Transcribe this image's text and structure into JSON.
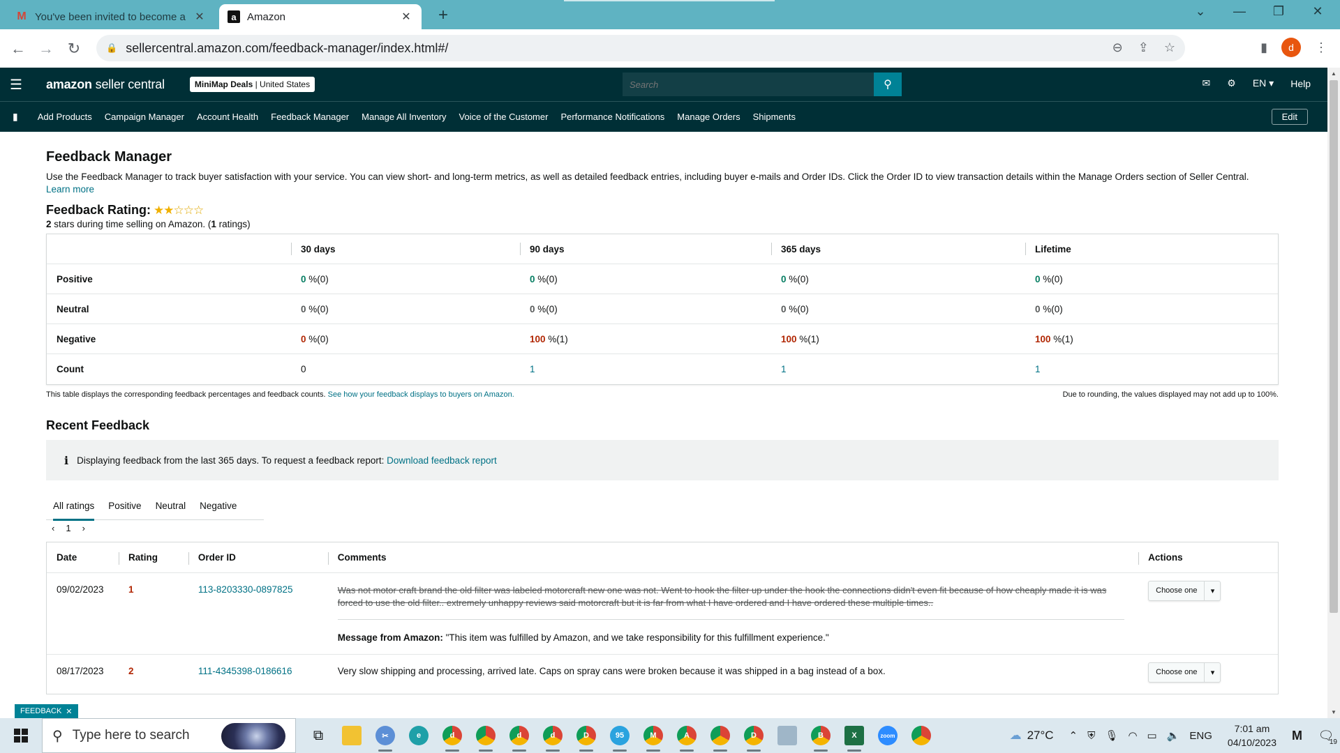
{
  "browser": {
    "tabs": [
      {
        "title": "You've been invited to become a",
        "icon": "gmail-icon",
        "active": false
      },
      {
        "title": "Amazon",
        "icon": "amazon-icon",
        "active": true
      }
    ],
    "url": "sellercentral.amazon.com/feedback-manager/index.html#/",
    "profile_initial": "d"
  },
  "header": {
    "logo_brand": "amazon",
    "logo_product": "seller central",
    "store_name": "MiniMap Deals",
    "store_region": "United States",
    "search_placeholder": "Search",
    "language": "EN",
    "help": "Help"
  },
  "nav": {
    "items": [
      "Add Products",
      "Campaign Manager",
      "Account Health",
      "Feedback Manager",
      "Manage All Inventory",
      "Voice of the Customer",
      "Performance Notifications",
      "Manage Orders",
      "Shipments"
    ],
    "edit": "Edit"
  },
  "page": {
    "title": "Feedback Manager",
    "intro": "Use the Feedback Manager to track buyer satisfaction with your service. You can view short- and long-term metrics, as well as detailed feedback entries, including buyer e-mails and Order IDs. Click the Order ID to view transaction details within the Manage Orders section of Seller Central.",
    "learn_more": "Learn more",
    "rating_label": "Feedback Rating:",
    "rating_stars": 2,
    "rating_max": 5,
    "rating_stars_value": "2",
    "rating_summary_mid": " stars during time selling on Amazon. (",
    "rating_count": "1",
    "rating_summary_end": " ratings)"
  },
  "metrics": {
    "columns": [
      "30 days",
      "90 days",
      "365 days",
      "Lifetime"
    ],
    "rows": [
      {
        "label": "Positive",
        "cells": [
          {
            "num": "0",
            "rest": " %(0)"
          },
          {
            "num": "0",
            "rest": " %(0)"
          },
          {
            "num": "0",
            "rest": " %(0)"
          },
          {
            "num": "0",
            "rest": " %(0)"
          }
        ]
      },
      {
        "label": "Neutral",
        "cells": [
          {
            "num": "0",
            "rest": " %(0)"
          },
          {
            "num": "0",
            "rest": " %(0)"
          },
          {
            "num": "0",
            "rest": " %(0)"
          },
          {
            "num": "0",
            "rest": " %(0)"
          }
        ]
      },
      {
        "label": "Negative",
        "cells": [
          {
            "num": "0",
            "rest": " %(0)"
          },
          {
            "num": "100",
            "rest": " %(1)"
          },
          {
            "num": "100",
            "rest": " %(1)"
          },
          {
            "num": "100",
            "rest": " %(1)"
          }
        ]
      },
      {
        "label": "Count",
        "cells": [
          {
            "num": "0",
            "rest": ""
          },
          {
            "num": "1",
            "rest": ""
          },
          {
            "num": "1",
            "rest": ""
          },
          {
            "num": "1",
            "rest": ""
          }
        ]
      }
    ],
    "note_left": "This table displays the corresponding feedback percentages and feedback counts.",
    "note_link": "See how your feedback displays to buyers on Amazon.",
    "note_right": "Due to rounding, the values displayed may not add up to 100%."
  },
  "recent": {
    "title": "Recent Feedback",
    "info_icon": "i",
    "info_text": "Displaying feedback from the last 365 days. To request a feedback report:",
    "info_link": "Download feedback report",
    "tabs": [
      "All ratings",
      "Positive",
      "Neutral",
      "Negative"
    ],
    "page": "1",
    "columns": [
      "Date",
      "Rating",
      "Order ID",
      "Comments",
      "Actions"
    ],
    "rows": [
      {
        "date": "09/02/2023",
        "rating": "1",
        "order_id": "113-8203330-0897825",
        "comment": "Was not motor craft brand the old filter was labeled motorcraft new one was not. Went to hook the filter up under the hook the connections didn't even fit because of how cheaply made it is was forced to use the old filter.. extremely unhappy reviews said motorcraft but it is far from what I have ordered and I have ordered these multiple times..",
        "message_label": "Message from Amazon:",
        "message": " \"This item was fulfilled by Amazon, and we take responsibility for this fulfillment experience.\"",
        "action": "Choose one"
      },
      {
        "date": "08/17/2023",
        "rating": "2",
        "order_id": "111-4345398-0186616",
        "comment": "Very slow shipping and processing, arrived late. Caps on spray cans were broken because it was shipped in a bag instead of a box.",
        "action": "Choose one"
      }
    ]
  },
  "feedback_badge": "FEEDBACK",
  "taskbar": {
    "search_placeholder": "Type here to search",
    "badge_telegram": "95",
    "weather_temp": "27°C",
    "language": "ENG",
    "time": "7:01 am",
    "date": "04/10/2023",
    "notifications": "19"
  },
  "colors": {
    "header_bg": "#002f36",
    "search_button": "#008296",
    "link": "#007185",
    "positive": "#067d62",
    "negative": "#b12704",
    "tabstrip": "#5fb3c2"
  }
}
